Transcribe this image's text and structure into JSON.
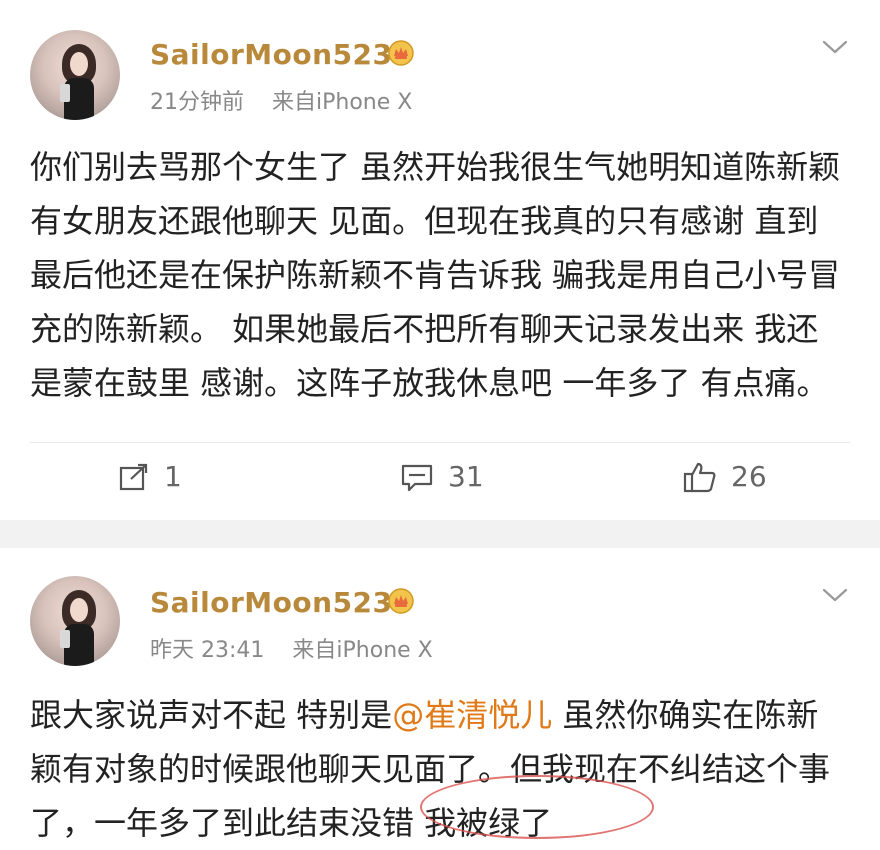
{
  "post1": {
    "username": "SailorMoon523",
    "time": "21分钟前",
    "source": "来自iPhone X",
    "content": "你们别去骂那个女生了 虽然开始我很生气她明知道陈新颖有女朋友还跟他聊天 见面。但现在我真的只有感谢 直到最后他还是在保护陈新颖不肯告诉我 骗我是用自己小号冒充的陈新颖。 如果她最后不把所有聊天记录发出来 我还是蒙在鼓里 感谢。这阵子放我休息吧 一年多了 有点痛。",
    "actions": {
      "repost": "1",
      "comments": "31",
      "likes": "26"
    }
  },
  "post2": {
    "username": "SailorMoon523",
    "time": "昨天 23:41",
    "source": "来自iPhone X",
    "content_before": "跟大家说声对不起 特别是",
    "mention": "@崔清悦儿",
    "content_after": " 虽然你确实在陈新颖有对象的时候跟他聊天见面了。但我现在不纠结这个事了，一年多了到此结束没错 我被绿了"
  },
  "icons": {
    "crown": "crown-badge-icon",
    "chevron": "chevron-down-icon",
    "repost": "repost-icon",
    "comment": "comment-icon",
    "like": "thumbs-up-icon"
  },
  "colors": {
    "username": "#b8893a",
    "mention": "#e07a19",
    "meta": "#888888"
  }
}
